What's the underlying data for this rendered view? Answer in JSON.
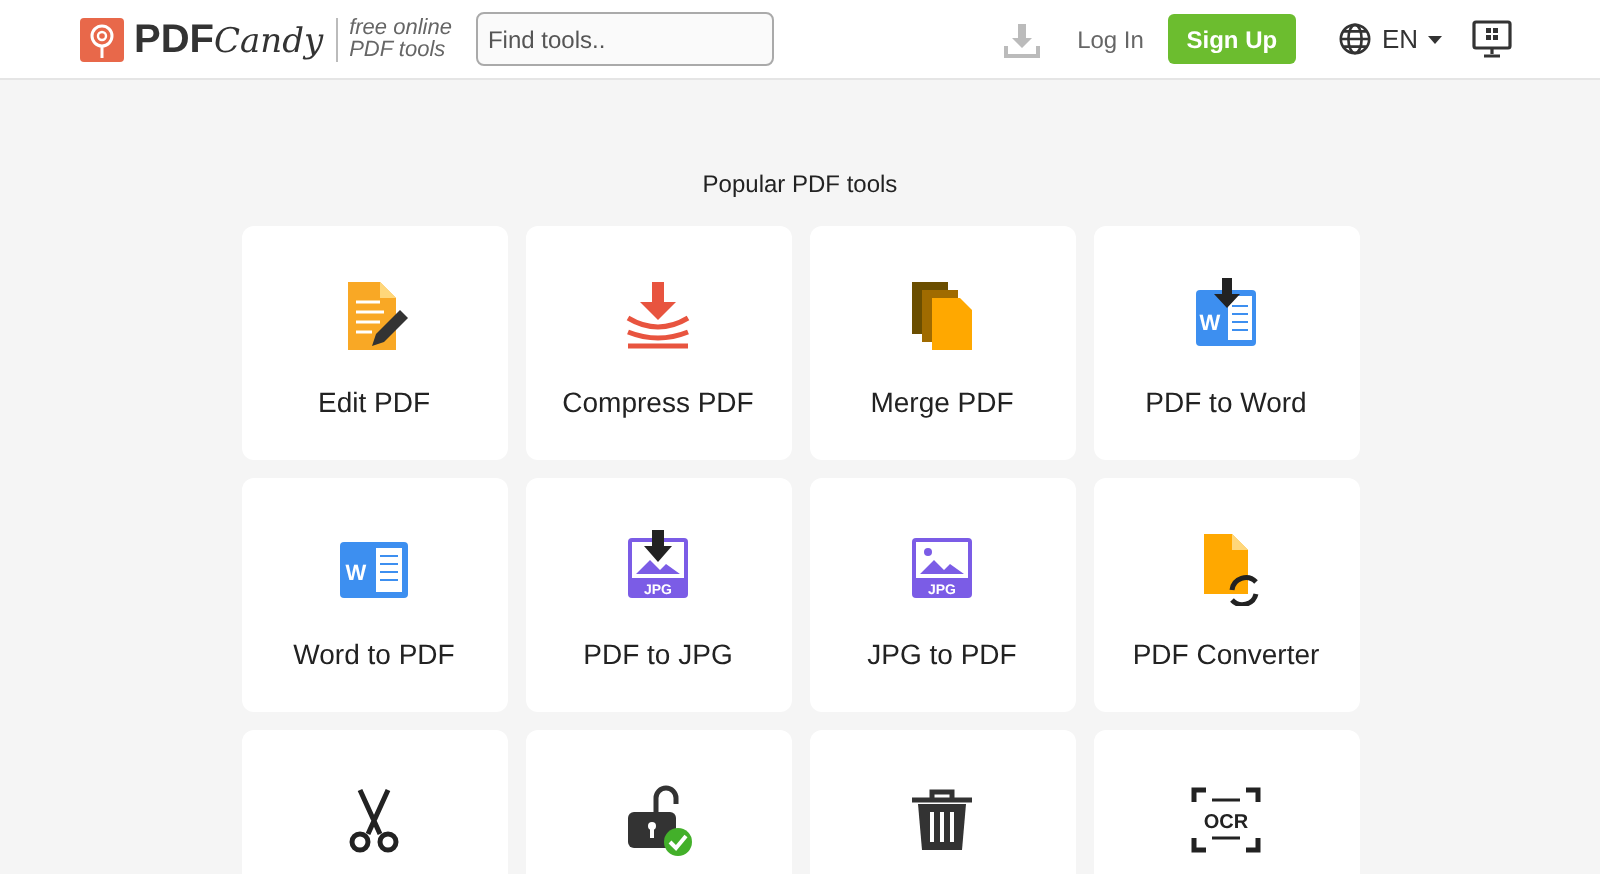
{
  "header": {
    "logo": {
      "bold": "PDF",
      "italic": "Candy"
    },
    "tagline": [
      "free online",
      "PDF tools"
    ],
    "search": {
      "placeholder": "Find tools.."
    },
    "login": "Log In",
    "signup": "Sign Up",
    "language": "EN"
  },
  "section_title": "Popular PDF tools",
  "tools": [
    {
      "kind": "edit",
      "label": "Edit PDF"
    },
    {
      "kind": "compress",
      "label": "Compress PDF"
    },
    {
      "kind": "merge",
      "label": "Merge PDF"
    },
    {
      "kind": "pdf_word",
      "label": "PDF to Word",
      "icon_text": "W"
    },
    {
      "kind": "word_pdf",
      "label": "Word to PDF",
      "icon_text": "W"
    },
    {
      "kind": "pdf_jpg",
      "label": "PDF to JPG",
      "icon_text": "JPG"
    },
    {
      "kind": "jpg_pdf",
      "label": "JPG to PDF",
      "icon_text": "JPG"
    },
    {
      "kind": "convert",
      "label": "PDF Converter"
    },
    {
      "kind": "split"
    },
    {
      "kind": "unlock"
    },
    {
      "kind": "delete"
    },
    {
      "kind": "ocr",
      "icon_text": "OCR"
    }
  ]
}
